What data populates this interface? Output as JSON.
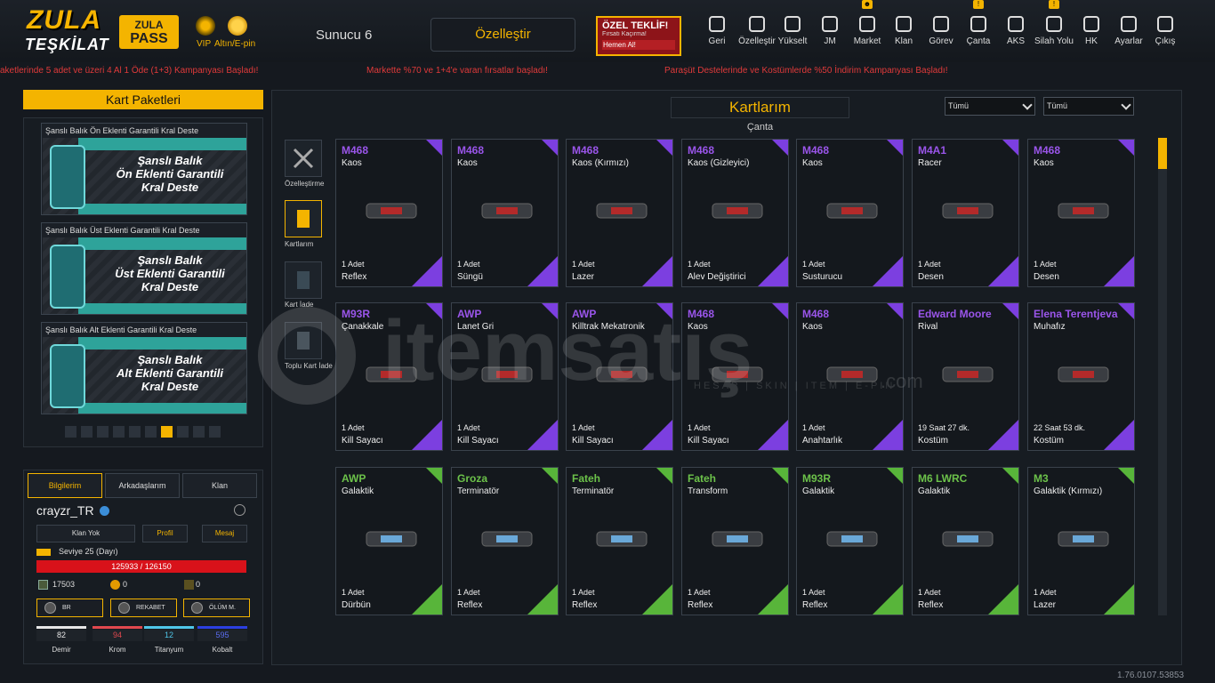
{
  "header": {
    "logo_top": "ZULA",
    "logo_bottom": "TEŞKİLAT",
    "pass_line1": "ZULA",
    "pass_line2": "PASS",
    "vip_label": "VIP",
    "gold_label": "Altın/E-pin",
    "server": "Sunucu 6",
    "customize_label": "Özelleştir",
    "offer_title": "ÖZEL TEKLİF!",
    "offer_sub": "Fırsatı Kaçırma!",
    "offer_btn": "Hemen Al!",
    "nav": [
      {
        "label": "Geri",
        "icon": "back-icon"
      },
      {
        "label": "Özelleştir",
        "icon": "tools-icon"
      },
      {
        "label": "Yükselt",
        "icon": "upgrade-icon"
      },
      {
        "label": "JM",
        "icon": "coins-icon"
      },
      {
        "label": "Market",
        "icon": "cart-icon",
        "badge": "☻"
      },
      {
        "label": "Klan",
        "icon": "clan-icon"
      },
      {
        "label": "Görev",
        "icon": "task-icon"
      },
      {
        "label": "Çanta",
        "icon": "bag-icon",
        "badge": "!"
      },
      {
        "label": "AKS",
        "icon": "crosshair-icon"
      },
      {
        "label": "Silah Yolu",
        "icon": "gun-icon",
        "badge": "!"
      },
      {
        "label": "HK",
        "icon": "wallet-icon"
      },
      {
        "label": "Ayarlar",
        "icon": "gear-icon"
      },
      {
        "label": "Çıkış",
        "icon": "power-icon"
      }
    ]
  },
  "ticker": [
    "aketlerinde 5 adet ve üzeri 4 Al 1 Öde (1+3) Kampanyası Başladı!",
    "Markette %70 ve 1+4'e varan fırsatlar başladı!",
    "Paraşüt Destelerinde ve Kostümlerde %50 İndirim Kampanyası Başladı!"
  ],
  "packages": {
    "title": "Kart Paketleri",
    "items": [
      {
        "title": "Şanslı Balık Ön Eklenti Garantili Kral Deste",
        "line1": "Şanslı Balık",
        "line2": "Ön Eklenti Garantili",
        "line3": "Kral Deste"
      },
      {
        "title": "Şanslı Balık Üst Eklenti Garantili Kral Deste",
        "line1": "Şanslı Balık",
        "line2": "Üst Eklenti Garantili",
        "line3": "Kral Deste"
      },
      {
        "title": "Şanslı Balık Alt Eklenti Garantili Kral Deste",
        "line1": "Şanslı Balık",
        "line2": "Alt Eklenti Garantili",
        "line3": "Kral Deste"
      }
    ],
    "page_count": 10,
    "active_page": 7
  },
  "profile": {
    "tabs": [
      "Bilgilerim",
      "Arkadaşlarım",
      "Klan"
    ],
    "username": "crayzr_TR",
    "buttons": [
      "Klan Yok",
      "Profil",
      "Mesaj"
    ],
    "level": "Seviye 25 (Dayı)",
    "xp": "125933 / 126150",
    "xp_fraction": 0.998,
    "currency1": "17503",
    "currency2": "0",
    "currency3": "0",
    "modes": [
      "BR",
      "REKABET",
      "ÖLÜM M."
    ],
    "metals": [
      {
        "name": "Demir",
        "value": "82",
        "color": "#e6e6e6",
        "text": "#e6e6e6"
      },
      {
        "name": "Krom",
        "value": "94",
        "color": "#e0484e",
        "text": "#e0484e"
      },
      {
        "name": "Titanyum",
        "value": "12",
        "color": "#4fc6e8",
        "text": "#4fc6e8"
      },
      {
        "name": "Kobalt",
        "value": "595",
        "color": "#2b3fe0",
        "text": "#5a6cf0"
      }
    ]
  },
  "main": {
    "title": "Kartlarım",
    "subtitle": "Çanta",
    "filter1": "Tümü",
    "filter2": "Tümü",
    "side": [
      "Özelleştirme",
      "Kartlarım",
      "Kart İade",
      "Toplu Kart İade"
    ],
    "cards": [
      {
        "name": "M468",
        "sub": "Kaos",
        "count": "1 Adet",
        "type": "Reflex",
        "rarity": "purple"
      },
      {
        "name": "M468",
        "sub": "Kaos",
        "count": "1 Adet",
        "type": "Süngü",
        "rarity": "purple"
      },
      {
        "name": "M468",
        "sub": "Kaos (Kırmızı)",
        "count": "1 Adet",
        "type": "Lazer",
        "rarity": "purple"
      },
      {
        "name": "M468",
        "sub": "Kaos (Gizleyici)",
        "count": "1 Adet",
        "type": "Alev Değiştirici",
        "rarity": "purple"
      },
      {
        "name": "M468",
        "sub": "Kaos",
        "count": "1 Adet",
        "type": "Susturucu",
        "rarity": "purple"
      },
      {
        "name": "M4A1",
        "sub": "Racer",
        "count": "1 Adet",
        "type": "Desen",
        "rarity": "purple"
      },
      {
        "name": "M468",
        "sub": "Kaos",
        "count": "1 Adet",
        "type": "Desen",
        "rarity": "purple"
      },
      {
        "name": "M93R",
        "sub": "Çanakkale",
        "count": "1 Adet",
        "type": "Kill Sayacı",
        "rarity": "purple"
      },
      {
        "name": "AWP",
        "sub": "Lanet Gri",
        "count": "1 Adet",
        "type": "Kill Sayacı",
        "rarity": "purple"
      },
      {
        "name": "AWP",
        "sub": "Killtrak Mekatronik",
        "count": "1 Adet",
        "type": "Kill Sayacı",
        "rarity": "purple"
      },
      {
        "name": "M468",
        "sub": "Kaos",
        "count": "1 Adet",
        "type": "Kill Sayacı",
        "rarity": "purple"
      },
      {
        "name": "M468",
        "sub": "Kaos",
        "count": "1 Adet",
        "type": "Anahtarlık",
        "rarity": "purple"
      },
      {
        "name": "Edward Moore",
        "sub": "Rival",
        "count": "19 Saat 27 dk.",
        "type": "Kostüm",
        "rarity": "purple"
      },
      {
        "name": "Elena Terentjeva",
        "sub": "Muhafız",
        "count": "22 Saat 53 dk.",
        "type": "Kostüm",
        "rarity": "purple"
      },
      {
        "name": "AWP",
        "sub": "Galaktik",
        "count": "1 Adet",
        "type": "Dürbün",
        "rarity": "green"
      },
      {
        "name": "Groza",
        "sub": "Terminatör",
        "count": "1 Adet",
        "type": "Reflex",
        "rarity": "green"
      },
      {
        "name": "Fateh",
        "sub": "Terminatör",
        "count": "1 Adet",
        "type": "Reflex",
        "rarity": "green"
      },
      {
        "name": "Fateh",
        "sub": "Transform",
        "count": "1 Adet",
        "type": "Reflex",
        "rarity": "green"
      },
      {
        "name": "M93R",
        "sub": "Galaktik",
        "count": "1 Adet",
        "type": "Reflex",
        "rarity": "green"
      },
      {
        "name": "M6 LWRC",
        "sub": "Galaktik",
        "count": "1 Adet",
        "type": "Reflex",
        "rarity": "green"
      },
      {
        "name": "M3",
        "sub": "Galaktik (Kırmızı)",
        "count": "1 Adet",
        "type": "Lazer",
        "rarity": "green"
      }
    ]
  },
  "watermark": {
    "main": "itemsatış",
    "sub": "HESAP | SKIN | ITEM | E-PIN",
    "dotcom": ".com"
  },
  "version": "1.76.0107.53853",
  "colors": {
    "accent": "#f4b400",
    "purple": "#7c3fe0",
    "green": "#58b53a",
    "purple_text": "#9a55ea",
    "green_text": "#6cc24a"
  }
}
